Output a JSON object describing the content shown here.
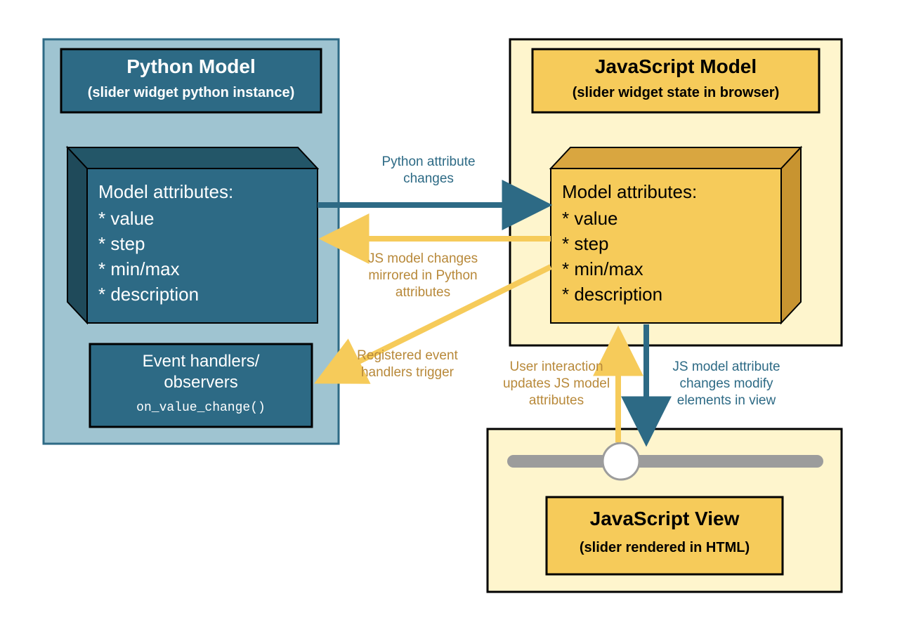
{
  "colors": {
    "teal_dark": "#2d6a85",
    "teal_light": "#9fc4d1",
    "teal_box": "#2d6a85",
    "yellow_light": "#fef5cd",
    "yellow_box": "#f6cb5a",
    "yellow_dark": "#d9a640",
    "arrow_teal": "#2d6a85",
    "arrow_gold": "#f6cb5a",
    "gray": "#9c9c9c"
  },
  "python_model": {
    "title": "Python Model",
    "subtitle": "(slider widget python instance)",
    "attr_title": "Model attributes:",
    "attrs": [
      "* value",
      "* step",
      "* min/max",
      "* description"
    ],
    "handlers_line1": "Event handlers/",
    "handlers_line2": "observers",
    "handlers_code": "on_value_change()"
  },
  "js_model": {
    "title": "JavaScript Model",
    "subtitle": "(slider widget state in browser)",
    "attr_title": "Model attributes:",
    "attrs": [
      "* value",
      "* step",
      "* min/max",
      "* description"
    ]
  },
  "js_view": {
    "title": "JavaScript View",
    "subtitle": "(slider rendered in HTML)"
  },
  "arrows": {
    "py_to_js": {
      "line1": "Python attribute",
      "line2": "changes"
    },
    "js_to_py": {
      "line1": "JS model changes",
      "line2": "mirrored in Python",
      "line3": "attributes"
    },
    "handlers_trigger": {
      "line1": "Registered event",
      "line2": "handlers trigger"
    },
    "user_to_model": {
      "line1": "User interaction",
      "line2": "updates JS model",
      "line3": "attributes"
    },
    "model_to_view": {
      "line1": "JS model attribute",
      "line2": "changes modify",
      "line3": "elements in view"
    }
  }
}
